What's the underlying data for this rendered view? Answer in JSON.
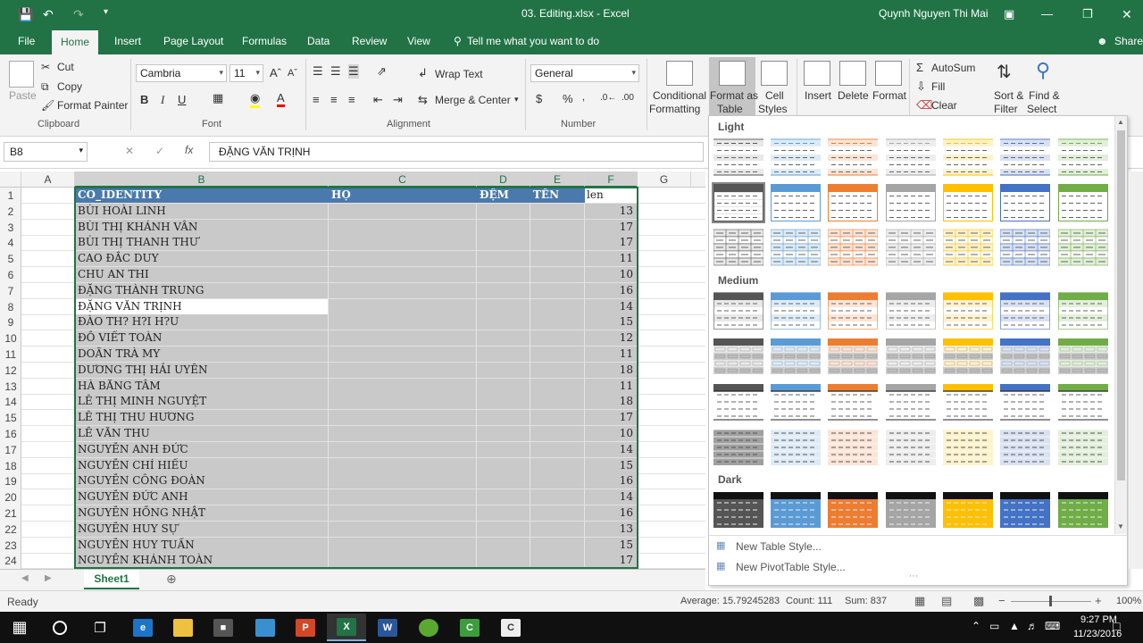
{
  "titlebar": {
    "doc_title": "03. Editing.xlsx  -  Excel",
    "user": "Quynh Nguyen Thi Mai",
    "save_icon": "save-icon",
    "undo_icon": "undo-icon",
    "redo_icon": "redo-icon"
  },
  "tabs": [
    {
      "label": "File"
    },
    {
      "label": "Home"
    },
    {
      "label": "Insert"
    },
    {
      "label": "Page Layout"
    },
    {
      "label": "Formulas"
    },
    {
      "label": "Data"
    },
    {
      "label": "Review"
    },
    {
      "label": "View"
    }
  ],
  "tell_me": "Tell me what you want to do",
  "share": "Share",
  "ribbon": {
    "clipboard": {
      "paste": "Paste",
      "cut": "Cut",
      "copy": "Copy",
      "format_painter": "Format Painter",
      "group": "Clipboard"
    },
    "font": {
      "name": "Cambria",
      "size": "11",
      "group": "Font",
      "bold": "B",
      "italic": "I",
      "underline": "U"
    },
    "alignment": {
      "wrap_text": "Wrap Text",
      "merge_center": "Merge & Center",
      "group": "Alignment"
    },
    "number": {
      "format": "General",
      "currency": "$",
      "percent": "%",
      "group": "Number"
    },
    "styles": {
      "conditional_formatting_1": "Conditional",
      "conditional_formatting_2": "Formatting",
      "format_as_table_1": "Format as",
      "format_as_table_2": "Table",
      "cell_styles_1": "Cell",
      "cell_styles_2": "Styles"
    },
    "cells": {
      "insert": "Insert",
      "delete": "Delete",
      "format": "Format"
    },
    "editing": {
      "autosum": "AutoSum",
      "fill": "Fill",
      "clear": "Clear",
      "sort_filter_1": "Sort &",
      "sort_filter_2": "Filter",
      "find_select_1": "Find &",
      "find_select_2": "Select"
    }
  },
  "formula_bar": {
    "name_box": "B8",
    "fx": "fx",
    "content": "ĐẶNG VĂN TRỊNH"
  },
  "columns": [
    "A",
    "B",
    "C",
    "D",
    "E",
    "F",
    "G"
  ],
  "header_row": {
    "B": "CO_IDENTITY",
    "C": "HỌ",
    "D": "ĐỆM",
    "E": "TÊN",
    "F": "len"
  },
  "rows": [
    {
      "num": "1"
    },
    {
      "num": "2",
      "name": "BÙI HOÀI LINH",
      "len": "13"
    },
    {
      "num": "3",
      "name": "BÙI THỊ KHÁNH VÂN",
      "len": "17"
    },
    {
      "num": "4",
      "name": "BÙI THỊ THANH THƯ",
      "len": "17"
    },
    {
      "num": "5",
      "name": "CAO ĐẮC DUY",
      "len": "11"
    },
    {
      "num": "6",
      "name": "CHU AN THI",
      "len": "10"
    },
    {
      "num": "7",
      "name": "ĐẶNG THÀNH TRUNG",
      "len": "16"
    },
    {
      "num": "8",
      "name": "ĐẶNG VĂN TRỊNH",
      "len": "14"
    },
    {
      "num": "9",
      "name": "ĐÀO TH? H?I H?U",
      "len": "15"
    },
    {
      "num": "10",
      "name": "ĐỖ VIẾT TOÀN",
      "len": "12"
    },
    {
      "num": "11",
      "name": "DOÃN TRÀ MY",
      "len": "11"
    },
    {
      "num": "12",
      "name": "DƯƠNG THỊ HẢI UYÊN",
      "len": "18"
    },
    {
      "num": "13",
      "name": "HÀ BĂNG TÂM",
      "len": "11"
    },
    {
      "num": "14",
      "name": "LÊ THỊ MINH NGUYỆT",
      "len": "18"
    },
    {
      "num": "15",
      "name": "LÊ THỊ THU HƯƠNG",
      "len": "17"
    },
    {
      "num": "16",
      "name": "LÊ VĂN THU",
      "len": "10"
    },
    {
      "num": "17",
      "name": "NGUYỄN ANH ĐỨC",
      "len": "14"
    },
    {
      "num": "18",
      "name": "NGUYỄN CHÍ HIẾU",
      "len": "15"
    },
    {
      "num": "19",
      "name": "NGUYỄN CÔNG ĐOÀN",
      "len": "16"
    },
    {
      "num": "20",
      "name": "NGUYỄN ĐỨC ANH",
      "len": "14"
    },
    {
      "num": "21",
      "name": "NGUYỄN HỒNG NHẬT",
      "len": "16"
    },
    {
      "num": "22",
      "name": "NGUYỄN HUY SỰ",
      "len": "13"
    },
    {
      "num": "23",
      "name": "NGUYỄN HUY TUẤN",
      "len": "15"
    },
    {
      "num": "24",
      "name": "NGUYỄN KHÁNH TOÀN",
      "len": "17"
    }
  ],
  "gallery": {
    "light": "Light",
    "medium": "Medium",
    "dark": "Dark",
    "new_table_style": "New Table Style...",
    "new_pivot_style": "New PivotTable Style...",
    "palette": [
      "#555555",
      "#5b9bd5",
      "#ed7d31",
      "#a5a5a5",
      "#ffc000",
      "#4472c4",
      "#70ad47"
    ],
    "palette_light": [
      "#e8e8e8",
      "#ddebf7",
      "#fce4d6",
      "#ededed",
      "#fff2cc",
      "#d9e1f2",
      "#e2efda"
    ]
  },
  "sheet_tab": "Sheet1",
  "status": {
    "ready": "Ready",
    "average": "Average: 15.79245283",
    "count": "Count: 111",
    "sum": "Sum: 837",
    "zoom": "100%"
  },
  "taskbar": {
    "time": "9:27 PM",
    "date": "11/23/2016"
  }
}
